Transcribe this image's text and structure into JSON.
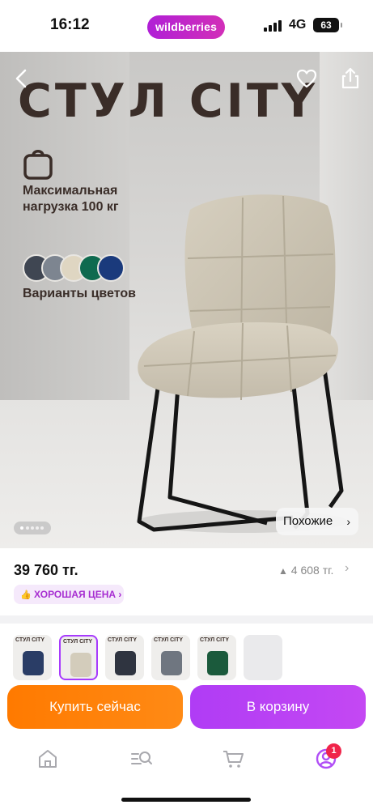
{
  "status_bar": {
    "time": "16:12",
    "app_pill": "wildberries",
    "network": "4G",
    "battery": "63"
  },
  "photo": {
    "brand_title": "СТУЛ CITY",
    "weight_text_line1": "Максимальная",
    "weight_text_line2": "нагрузка 100 кг",
    "colors_text": "Варианты цветов",
    "swatch_colors": [
      "#3f4652",
      "#7d8590",
      "#dfd6c2",
      "#0f6a4f",
      "#1a3a7c"
    ],
    "similar_label": "Похожие",
    "gallery_count": 5,
    "gallery_current": 1
  },
  "price": {
    "current": "39 760 тг.",
    "old": "4 608 тг.",
    "good_price_label": "ХОРОШАЯ ЦЕНА"
  },
  "variants": {
    "label": "СТУЛ CITY",
    "items": [
      {
        "color": "#2a3d66",
        "selected": false
      },
      {
        "color": "#d3ccbb",
        "selected": true
      },
      {
        "color": "#2f3440",
        "selected": false
      },
      {
        "color": "#6f7680",
        "selected": false
      },
      {
        "color": "#1b5a3c",
        "selected": false
      }
    ]
  },
  "actions": {
    "buy_now": "Купить сейчас",
    "to_cart": "В корзину"
  },
  "tabbar": {
    "items": [
      "home-icon",
      "catalog-search-icon",
      "cart-icon",
      "profile-icon"
    ],
    "profile_badge": "1"
  },
  "colors": {
    "accent_purple": "#a73afd",
    "accent_orange": "#ff7a00",
    "badge_red": "#f0244a"
  }
}
